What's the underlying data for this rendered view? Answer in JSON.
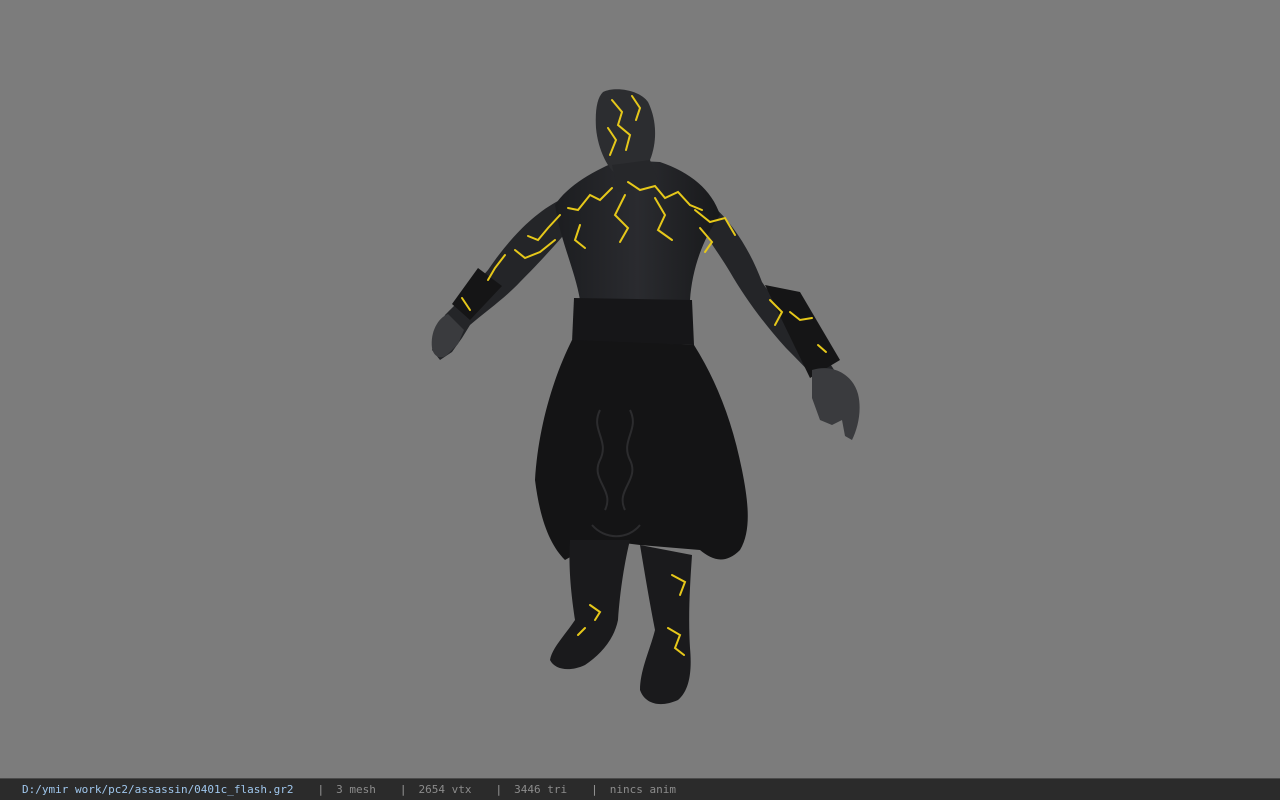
{
  "viewer": {
    "background_color": "#7c7c7c",
    "model_name": "0401c_flash",
    "glow_color": "#e6c81a"
  },
  "status_bar": {
    "file_path": "D:/ymir work/pc2/assassin/0401c_flash.gr2",
    "separator": "|",
    "mesh_count": "3 mesh",
    "vertex_count": "2654 vtx",
    "triangle_count": "3446 tri",
    "anim_status": "nincs anim"
  }
}
